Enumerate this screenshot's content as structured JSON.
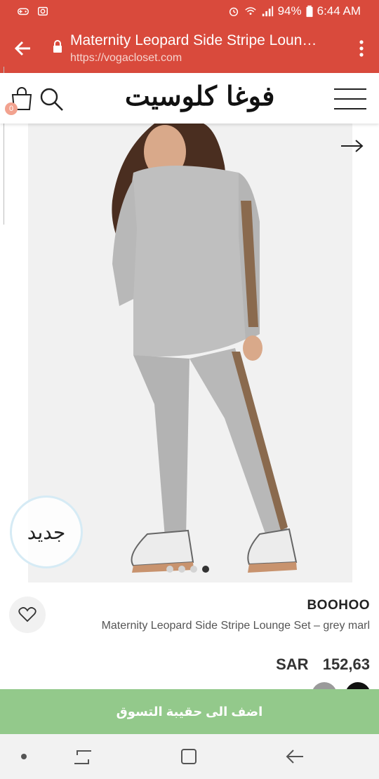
{
  "status_bar": {
    "battery": "94%",
    "time": "6:44 AM",
    "left_icons": [
      "game-controller-icon",
      "image-icon"
    ],
    "right_icons": [
      "alarm-icon",
      "wifi-icon",
      "signal-icon",
      "battery-icon"
    ]
  },
  "browser": {
    "title": "Maternity Leopard Side Stripe Loun…",
    "url": "https://vogacloset.com"
  },
  "header": {
    "logo": "فوغا كلوسيت",
    "bag_count": "0"
  },
  "product": {
    "badge": "جديد",
    "brand": "BOOHOO",
    "name": "Maternity Leopard Side Stripe Lounge Set – grey marl",
    "currency": "SAR",
    "price": "152,63",
    "image_count": 4,
    "active_image": 4
  },
  "actions": {
    "add_to_bag": "اضف الى حقيبة التسوق"
  },
  "colors": {
    "brand_red": "#d94a3c",
    "add_green": "#93c98b"
  }
}
